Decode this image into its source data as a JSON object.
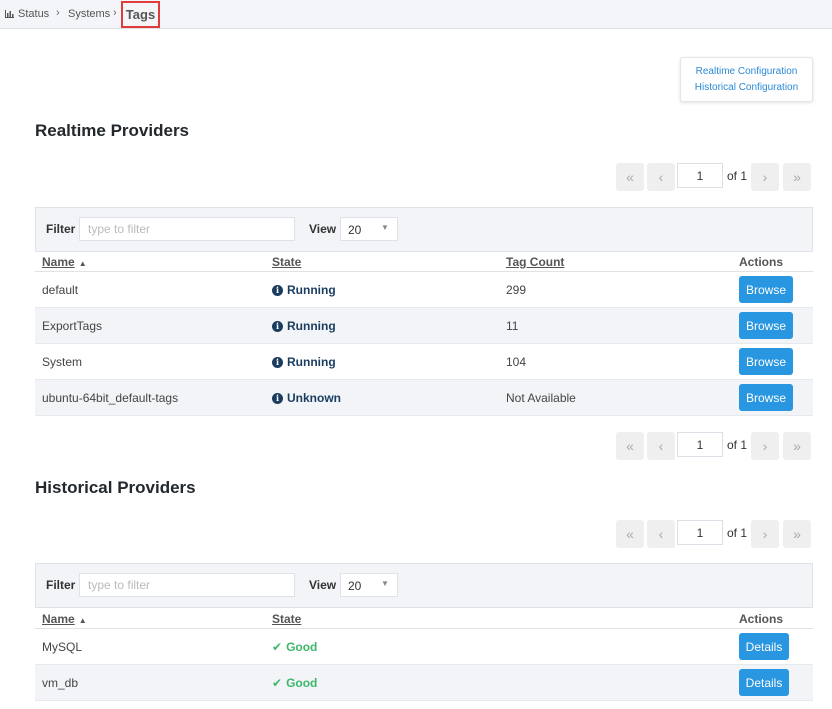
{
  "breadcrumb": {
    "icon": "bar-chart-icon",
    "items": [
      "Status",
      "Systems"
    ],
    "separator": "›",
    "current": "Tags"
  },
  "config_links": {
    "realtime": "Realtime Configuration",
    "historical": "Historical Configuration"
  },
  "colors": {
    "accent": "#2896e0",
    "link": "#2b8ad6",
    "state_info": "#1a3d5f",
    "state_good": "#3db86b",
    "highlight_border": "#e03c3c"
  },
  "pager_common": {
    "first": "«",
    "prev": "‹",
    "next": "›",
    "last": "»"
  },
  "realtime": {
    "title": "Realtime Providers",
    "pager_top": {
      "page": "1",
      "of_label": "of 1"
    },
    "pager_bottom": {
      "page": "1",
      "of_label": "of 1"
    },
    "filter": {
      "label": "Filter",
      "placeholder": "type to filter",
      "value": ""
    },
    "view": {
      "label": "View",
      "value": "20",
      "arrow": "▼"
    },
    "columns": {
      "name": "Name",
      "state": "State",
      "tag_count": "Tag Count",
      "actions": "Actions",
      "sort_arrow": "▲"
    },
    "rows": [
      {
        "name": "default",
        "state": "Running",
        "tag_count": "299",
        "action": "Browse"
      },
      {
        "name": "ExportTags",
        "state": "Running",
        "tag_count": "11",
        "action": "Browse"
      },
      {
        "name": "System",
        "state": "Running",
        "tag_count": "104",
        "action": "Browse"
      },
      {
        "name": "ubuntu-64bit_default-tags",
        "state": "Unknown",
        "tag_count": "Not Available",
        "action": "Browse"
      }
    ]
  },
  "historical": {
    "title": "Historical Providers",
    "pager_top": {
      "page": "1",
      "of_label": "of 1"
    },
    "filter": {
      "label": "Filter",
      "placeholder": "type to filter",
      "value": ""
    },
    "view": {
      "label": "View",
      "value": "20",
      "arrow": "▼"
    },
    "columns": {
      "name": "Name",
      "state": "State",
      "actions": "Actions",
      "sort_arrow": "▲"
    },
    "rows": [
      {
        "name": "MySQL",
        "state": "Good",
        "action": "Details"
      },
      {
        "name": "vm_db",
        "state": "Good",
        "action": "Details"
      }
    ]
  },
  "icons": {
    "info": "i",
    "check": "✔"
  }
}
